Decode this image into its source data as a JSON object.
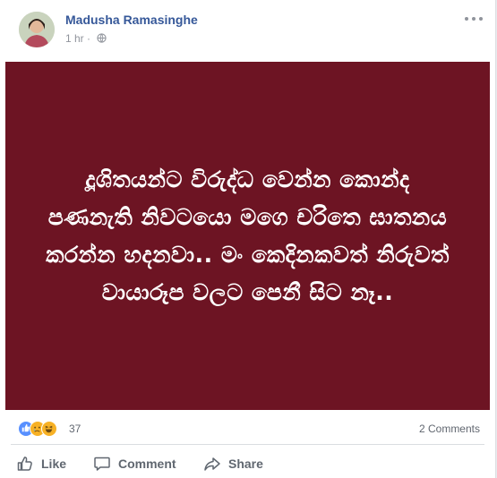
{
  "post": {
    "author": "Madusha Ramasinghe",
    "time": "1 hr",
    "privacy_icon": "globe-icon",
    "menu_icon": "more-options-icon",
    "image_text": "දූශිතයන්ට විරුද්ධ වෙන්න කොන්ද පණනැති නිවටයො මගෙ චරිතෙ ඝාතනය කරන්න හදනවා.. මං කෙදිනකවත් නිරුවත් වායාරූප වලට පෙනී සිට නෑ..",
    "image_bg": "#6d1423"
  },
  "reactions": {
    "icons": [
      "like-icon",
      "sad-icon",
      "haha-icon"
    ],
    "count": "37",
    "comments": "2 Comments"
  },
  "actions": {
    "like": "Like",
    "comment": "Comment",
    "share": "Share"
  },
  "colors": {
    "link": "#365899",
    "muted": "#90949c",
    "action_text": "#606770"
  }
}
